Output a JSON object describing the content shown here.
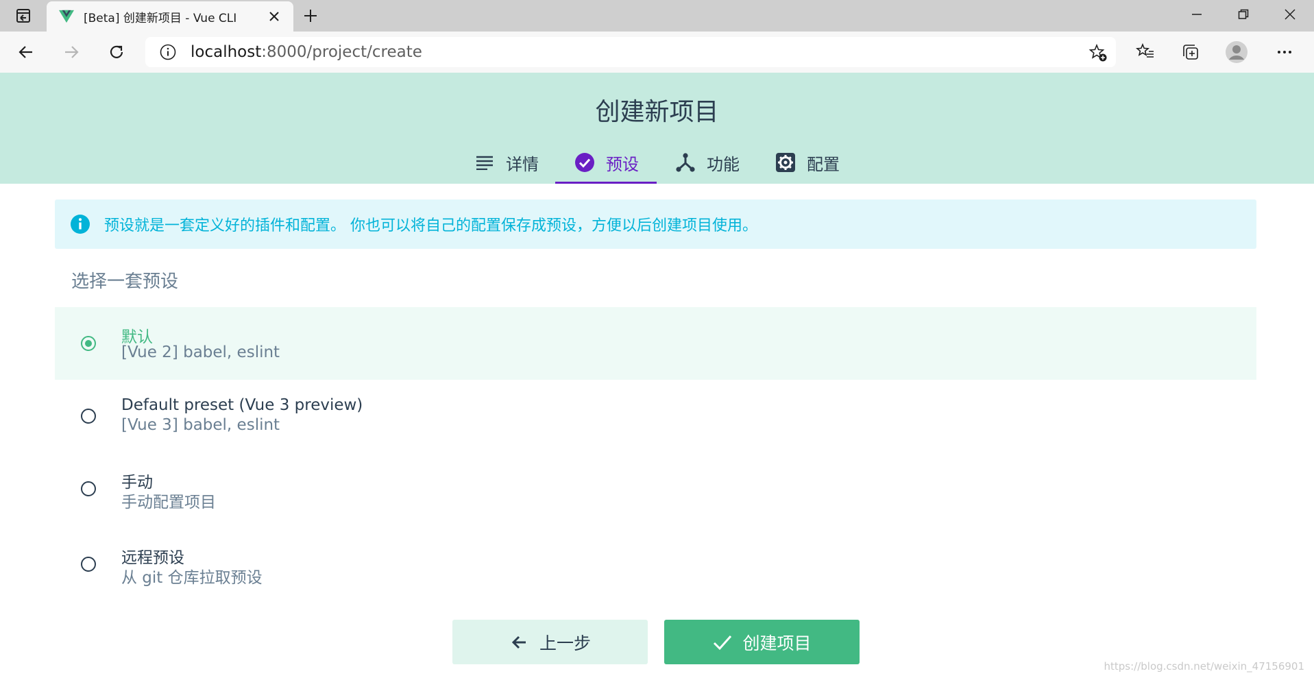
{
  "browser": {
    "tab_title": "[Beta] 创建新项目 - Vue CLI",
    "url_host": "localhost",
    "url_rest": ":8000/project/create"
  },
  "header": {
    "title": "创建新项目",
    "steps": [
      {
        "label": "详情",
        "icon": "list-icon"
      },
      {
        "label": "预设",
        "icon": "check-circle-icon"
      },
      {
        "label": "功能",
        "icon": "fork-icon"
      },
      {
        "label": "配置",
        "icon": "gear-icon"
      }
    ],
    "active_step": "预设"
  },
  "banner": {
    "text": "预设就是一套定义好的插件和配置。 你也可以将自己的配置保存成预设，方便以后创建项目使用。",
    "icon": "info-icon"
  },
  "section_label": "选择一套预设",
  "presets": [
    {
      "name": "默认",
      "desc": "[Vue 2] babel, eslint",
      "selected": true
    },
    {
      "name": "Default preset (Vue 3 preview)",
      "desc": "[Vue 3] babel, eslint",
      "selected": false
    },
    {
      "name": "手动",
      "desc": "手动配置项目",
      "selected": false
    },
    {
      "name": "远程预设",
      "desc": "从 git 仓库拉取预设",
      "selected": false
    }
  ],
  "buttons": {
    "prev_label": "上一步",
    "create_label": "创建项目"
  },
  "watermark": "https://blog.csdn.net/weixin_47156901",
  "colors": {
    "accent_green": "#42b983",
    "active_purple": "#6a1fc4",
    "header_bg": "#c5eadf",
    "info_blue": "#02b3d8",
    "text_dark": "#2c3e50"
  }
}
